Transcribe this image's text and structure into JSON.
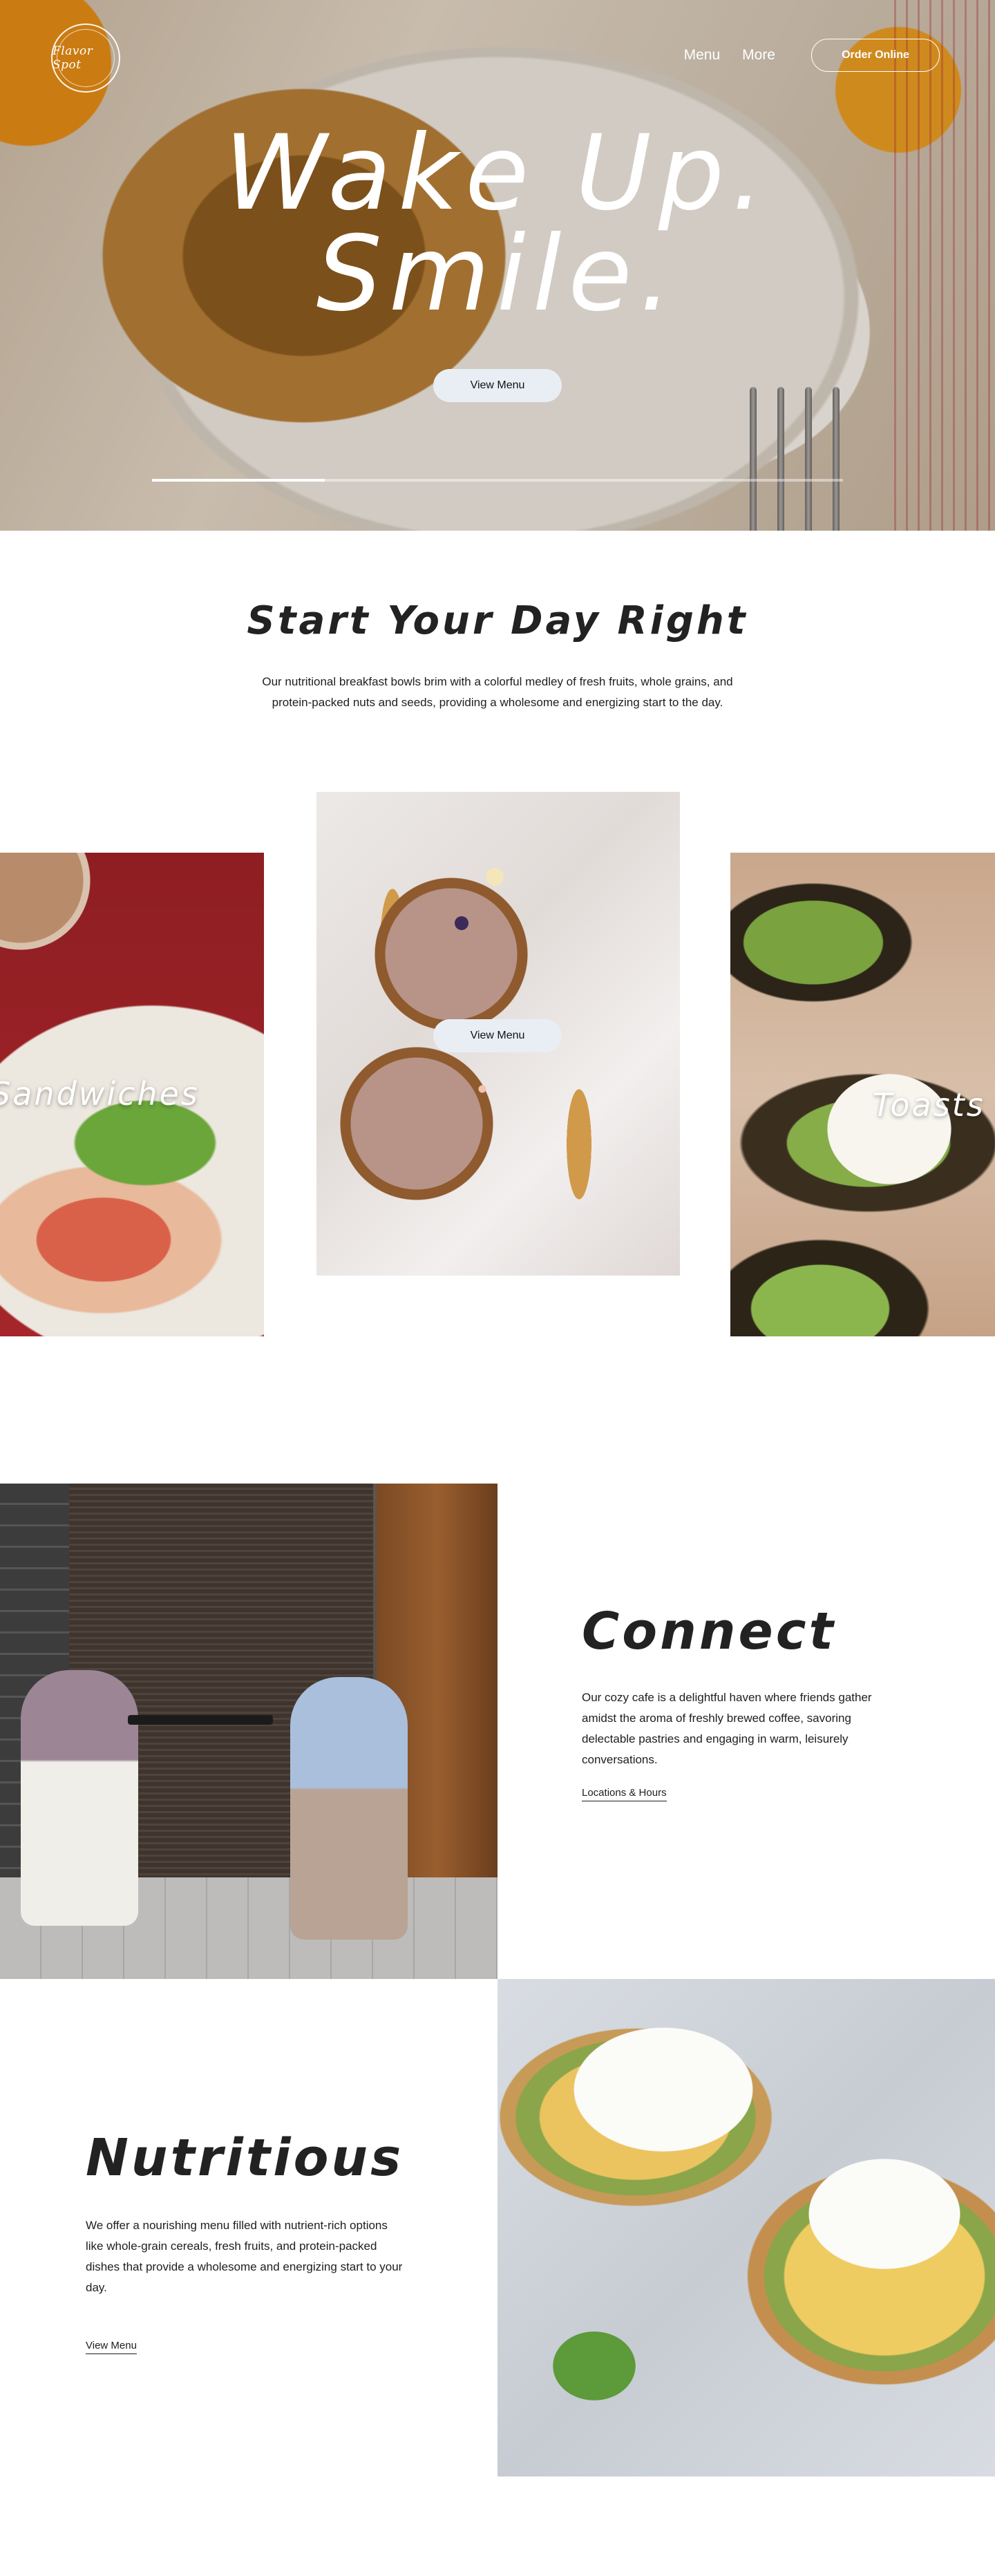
{
  "brand": {
    "logo_text": "Flavor Spot"
  },
  "nav": {
    "menu": "Menu",
    "more": "More",
    "order_online": "Order Online"
  },
  "hero": {
    "title_line1": "Wake Up.",
    "title_line2": "Smile.",
    "button": "View Menu",
    "slide_progress": 0.25
  },
  "intro": {
    "title": "Start Your Day Right",
    "text": "Our nutritional breakfast bowls brim with a colorful medley of fresh fruits, whole grains, and protein-packed nuts and seeds, providing a wholesome and energizing start to the day."
  },
  "carousel": {
    "left_label": "Sandwiches",
    "right_label": "Toasts",
    "button": "View Menu"
  },
  "connect": {
    "heading": "Connect",
    "text": "Our cozy cafe is a delightful haven where friends gather amidst the aroma of freshly brewed coffee, savoring delectable pastries and engaging in warm, leisurely conversations.",
    "link": "Locations & Hours"
  },
  "nutritious": {
    "heading": "Nutritious",
    "text": "We offer a nourishing menu filled with nutrient-rich options like whole-grain cereals, fresh fruits, and protein-packed dishes that provide a wholesome and energizing start to your day.",
    "link": "View Menu"
  }
}
